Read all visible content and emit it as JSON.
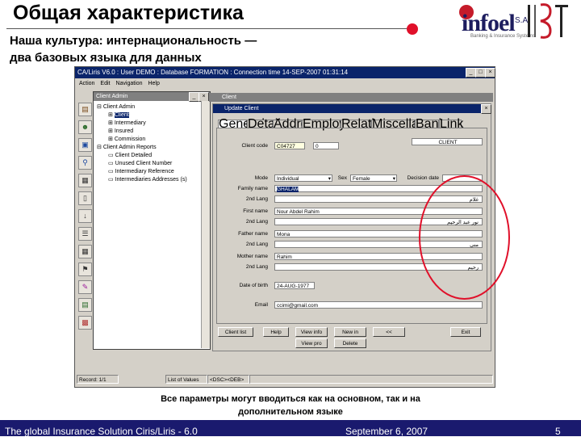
{
  "slide": {
    "title": "Общая характеристика",
    "subtitle_line1": "Наша культура: интернациональность —",
    "subtitle_line2": "два базовых языка для данных",
    "caption_line1": "Все параметры могут вводиться как на основном, так и на",
    "caption_line2": "дополнительном языке",
    "footer_left": "The global Insurance Solution  Ciris/Liris - 6.0",
    "footer_date": "September 6, 2007",
    "page_number": "5",
    "logo_text": "infoel",
    "logo_sa": "S.A",
    "logo_tag": "Banking & Insurance Systems",
    "footer_color": "#1a1a6e",
    "accent_red": "#e0102a"
  },
  "window": {
    "title": "CA/Liris V6.0 : User DEMO : Database FORMATION : Connection time 14-SEP-2007 01:31:14",
    "menu": [
      "Action",
      "Edit",
      "Navigation",
      "Help"
    ],
    "toolbar_icons": [
      "book-icon",
      "user-icon",
      "folder-icon",
      "find-icon",
      "print-icon",
      "doc-icon",
      "arrow-icon",
      "list-icon",
      "grid-icon",
      "flag-icon",
      "tool-icon",
      "report-icon",
      "image-icon",
      "exit-icon"
    ]
  },
  "client_admin": {
    "title": "Client Admin",
    "tree": [
      "Client Admin",
      "Client",
      "Intermediary",
      "Insured",
      "Commission",
      "Client Admin Reports",
      "Client Detailed",
      "Unused Client Number",
      "Intermediary Reference",
      "Intermediaries Addresses (s)"
    ]
  },
  "client_child": {
    "title": "Client"
  },
  "update_client": {
    "title": "Update Client",
    "tabs": [
      "General",
      "Detail",
      "Address",
      "Employment",
      "Relation",
      "Miscellaneous",
      "Bank",
      "Link"
    ],
    "client_code_label": "Client code",
    "client_code_value": "C04727",
    "client_code_suffix": "0",
    "client_type": "CLIENT",
    "mode_label": "Mode",
    "mode_value": "Individual",
    "sex_label": "Sex",
    "sex_value": "Female",
    "decision_label": "Decision date",
    "family_label": "Family name",
    "family_value": "GHALAM",
    "family_second_label": "2nd Lang",
    "family_arabic": "غلام",
    "first_label": "First name",
    "first_value": "Nour Abdel Rahim",
    "first_second_label": "2nd Lang",
    "first_arabic": "نور عبد الرحيم",
    "father_label": "Father name",
    "father_value": "Mona",
    "father_second_label": "2nd Lang",
    "father_arabic": "منى",
    "mother_label": "Mother name",
    "mother_value": "Rahim",
    "mother_second_label": "2nd Lang",
    "mother_arabic": "رحيم",
    "dob_label": "Date of birth",
    "dob_value": "24-AUG-1977",
    "email_label": "Email",
    "email_value": "ccimi@gmail.com",
    "buttons_row1": [
      "Client list",
      "Help",
      "View info",
      "New in",
      "<<",
      "Exit"
    ],
    "buttons_row2": [
      "View pro",
      "Delete"
    ]
  },
  "status_bar": {
    "record": "Record: 1/1",
    "list_values": "List of Values",
    "mode": "<DSC><DEB>"
  }
}
